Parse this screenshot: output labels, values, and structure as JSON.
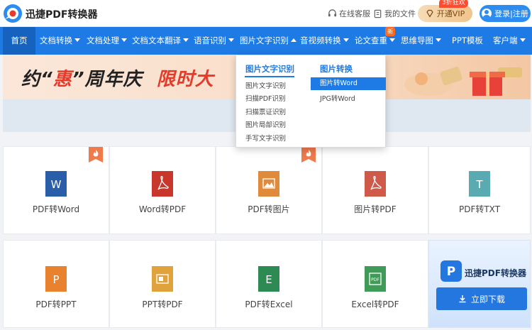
{
  "header": {
    "brand": "迅捷PDF转换器",
    "service_label": "在线客服",
    "files_label": "我的文件",
    "vip_label": "开通VIP",
    "vip_tag": "3折狂欢",
    "login_label": "登录|注册"
  },
  "nav": {
    "items": [
      "首页",
      "文档转换",
      "文档处理",
      "文档文本翻译",
      "语音识别",
      "图片文字识别",
      "音视频转换",
      "论文查重",
      "思维导图",
      "PPT模板",
      "客户端"
    ],
    "new_badge": "新"
  },
  "banner": {
    "text_part1": "约“",
    "text_part2": "惠",
    "text_part3": "”周年庆",
    "text_part4": "限时大"
  },
  "dropdown": {
    "col1_title": "图片文字识别",
    "col1_items": [
      "图片文字识别",
      "扫描PDF识别",
      "扫描票证识别",
      "图片局部识别",
      "手写文字识别"
    ],
    "col2_title": "图片转换",
    "col2_items": [
      "图片转Word",
      "JPG转Word"
    ]
  },
  "tools": {
    "row1": [
      "PDF转Word",
      "Word转PDF",
      "PDF转图片",
      "图片转PDF",
      "PDF转TXT"
    ],
    "row2": [
      "PDF转PPT",
      "PPT转PDF",
      "PDF转Excel",
      "Excel转PDF"
    ]
  },
  "promo": {
    "title": "迅捷PDF转换器",
    "button_label": "立即下载"
  },
  "colors": {
    "primary": "#1e7be6",
    "word": "#2a5ea8",
    "pdf": "#c9372c",
    "image": "#e08a3c",
    "txt": "#5aaab2",
    "ppt": "#e8822f",
    "ppt_pdf": "#e0a23a",
    "excel": "#2c8a52",
    "excel_pdf": "#3f9b57"
  }
}
